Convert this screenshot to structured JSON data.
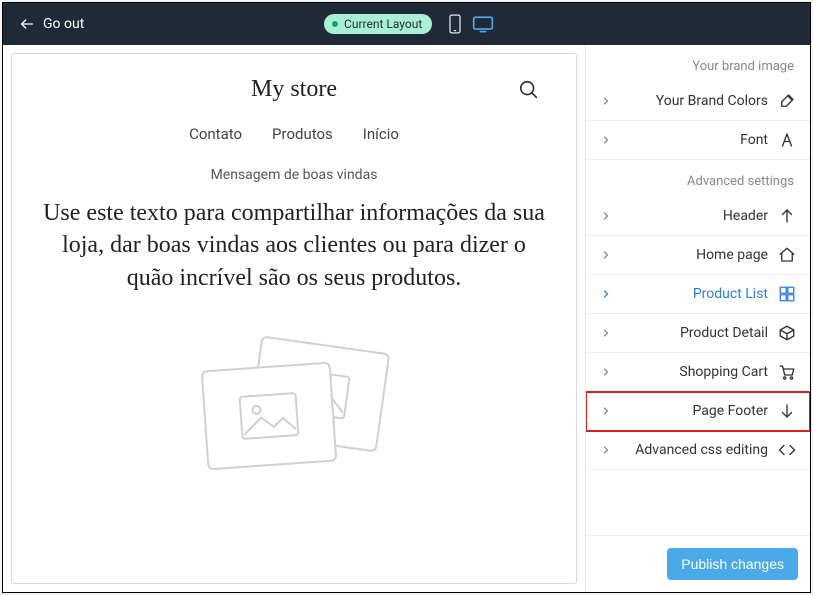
{
  "topbar": {
    "go_out": "Go out",
    "badge": "Current Layout"
  },
  "sidebar": {
    "group_brand": "Your brand image",
    "group_advanced": "Advanced settings",
    "items": {
      "brand_colors": "Your Brand Colors",
      "font": "Font",
      "header": "Header",
      "home_page": "Home page",
      "product_list": "Product List",
      "product_detail": "Product Detail",
      "shopping_cart": "Shopping Cart",
      "page_footer": "Page Footer",
      "advanced_css": "Advanced css editing"
    },
    "publish": "Publish changes"
  },
  "preview": {
    "store_name": "My store",
    "nav": {
      "inicio": "Início",
      "produtos": "Produtos",
      "contato": "Contato"
    },
    "welcome_label": "Mensagem de boas vindas",
    "welcome_text": "Use este texto para compartilhar informações da sua loja, dar boas vindas aos clientes ou para dizer o quão incrível são os seus produtos."
  }
}
